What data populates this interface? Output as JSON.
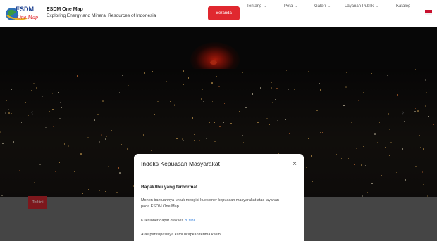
{
  "brand": {
    "title": "ESDM One Map",
    "subtitle": "Exploring Energy and Mineral Resources of Indonesia",
    "logo_text_top": "ESDM",
    "logo_text_bottom": "One Map"
  },
  "nav": {
    "items": [
      {
        "label": "Beranda",
        "active": true
      },
      {
        "label": "Tentang",
        "dropdown": true
      },
      {
        "label": "Peta",
        "dropdown": true
      },
      {
        "label": "Galeri",
        "dropdown": true
      },
      {
        "label": "Layanan Publik",
        "dropdown": true
      },
      {
        "label": "Katalog",
        "dropdown": false
      }
    ],
    "language_flag": "flag-indonesia-icon"
  },
  "hero": {
    "prev_arrow": "‹",
    "next_arrow": "›"
  },
  "terkini_label": "Terkini",
  "modal": {
    "title": "Indeks Kepuasan Masyarakat",
    "close_symbol": "×",
    "greeting": "Bapak/Ibu yang terhormat",
    "line1": "Mohon bantuannya untuk mengisi kuesioner kepuasan masyarakat atas layanan",
    "line2": "pada ESDM One Map",
    "access_prefix": "Kuesioner dapat diakses",
    "access_link": "di sini",
    "thanks": "Atas partisipasinya kami ucapkan terima kasih"
  },
  "colors": {
    "accent": "#e0282f",
    "link": "#1a6fd6"
  }
}
